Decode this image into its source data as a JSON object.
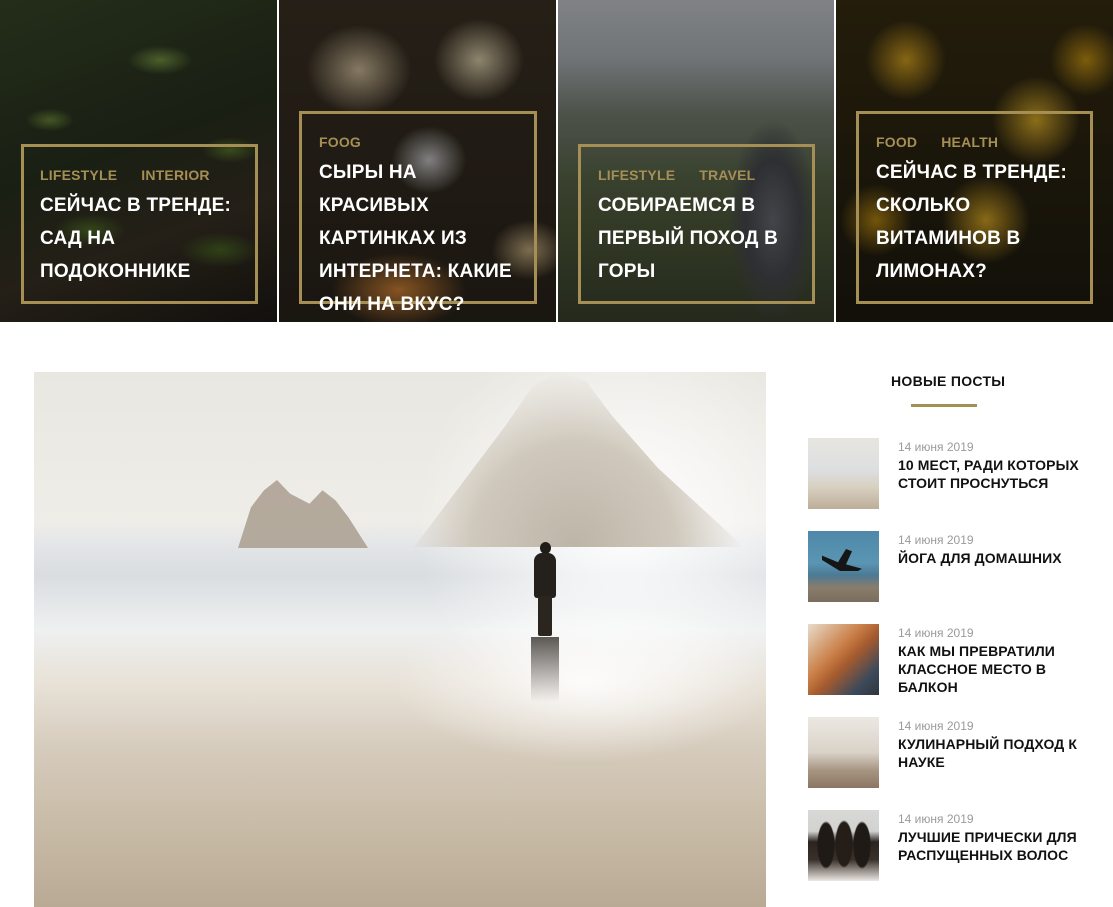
{
  "featured": [
    {
      "categories": [
        "LIFESTYLE",
        "INTERIOR"
      ],
      "title": "СЕЙЧАС В ТРЕНДЕ: САД НА ПОДОКОННИКЕ"
    },
    {
      "categories": [
        "FOOG"
      ],
      "title": "СЫРЫ НА КРАСИВЫХ КАРТИНКАХ ИЗ ИНТЕРНЕТА: КАКИЕ ОНИ НА ВКУС?"
    },
    {
      "categories": [
        "LIFESTYLE",
        "TRAVEL"
      ],
      "title": "СОБИРАЕМСЯ В ПЕРВЫЙ ПОХОД В ГОРЫ"
    },
    {
      "categories": [
        "FOOD",
        "HEALTH"
      ],
      "title": "СЕЙЧАС В ТРЕНДЕ: СКОЛЬКО ВИТАМИНОВ В ЛИМОНАХ?"
    }
  ],
  "sidebar": {
    "title": "НОВЫЕ ПОСТЫ",
    "posts": [
      {
        "date": "14 июня 2019",
        "title": "10 МЕСТ, РАДИ КОТОРЫХ СТОИТ ПРОСНУТЬСЯ"
      },
      {
        "date": "14 июня 2019",
        "title": "ЙОГА ДЛЯ ДОМАШНИХ"
      },
      {
        "date": "14 июня 2019",
        "title": "КАК МЫ ПРЕВРАТИЛИ КЛАССНОЕ МЕСТО В БАЛКОН"
      },
      {
        "date": "14 июня 2019",
        "title": "КУЛИНАРНЫЙ ПОДХОД К НАУКЕ"
      },
      {
        "date": "14 июня 2019",
        "title": "ЛУЧШИЕ ПРИЧЕСКИ ДЛЯ РАСПУЩЕННЫХ ВОЛОС"
      }
    ]
  },
  "colors": {
    "accent": "#a58f55",
    "text": "#111111",
    "muted": "#9a9a9a"
  }
}
